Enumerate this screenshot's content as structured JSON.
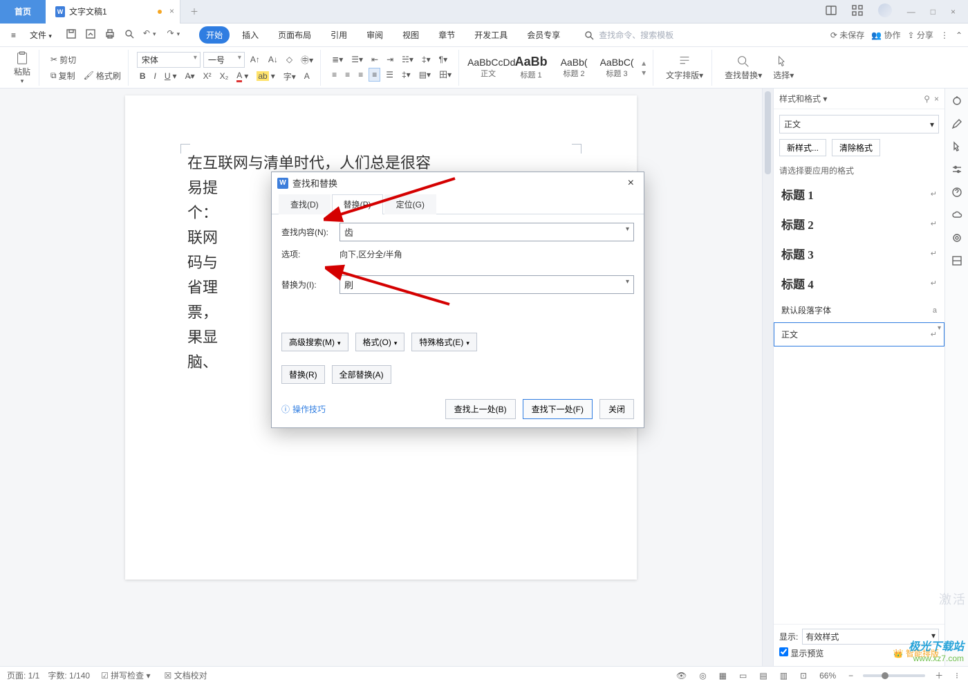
{
  "tabs": {
    "home": "首页",
    "doc": "文字文稿1"
  },
  "window": {
    "min": "—",
    "max": "□",
    "close": "×"
  },
  "menubar": {
    "file": "文件",
    "tabs": [
      "开始",
      "插入",
      "页面布局",
      "引用",
      "审阅",
      "视图",
      "章节",
      "开发工具",
      "会员专享"
    ],
    "search_placeholder": "查找命令、搜索模板",
    "unsaved": "未保存",
    "collab": "协作",
    "share": "分享"
  },
  "ribbon": {
    "paste": "粘贴",
    "cut": "剪切",
    "copy": "复制",
    "format_painter": "格式刷",
    "font_name": "宋体",
    "font_size": "一号",
    "styles": {
      "s0": {
        "preview": "AaBbCcDd",
        "label": "正文"
      },
      "s1": {
        "preview": "AaBb",
        "label": "标题 1"
      },
      "s2": {
        "preview": "AaBb(",
        "label": "标题 2"
      },
      "s3": {
        "preview": "AaBbC(",
        "label": "标题 3"
      }
    },
    "text_layout": "文字排版",
    "find_replace": "查找替换",
    "select": "选择"
  },
  "doc_lines": [
    "在互联网与清单时代，人们总是很容",
    "易提",
    "个：",
    "联网",
    "码与",
    "省理",
    "票，",
    "果显",
    "脑、"
  ],
  "dialog": {
    "title": "查找和替换",
    "tabs": {
      "find": "查找(D)",
      "replace": "替换(P)",
      "goto": "定位(G)"
    },
    "find_label": "查找内容(N):",
    "find_value": "齿",
    "options_label": "选项:",
    "options_value": "向下,区分全/半角",
    "replace_label": "替换为(I):",
    "replace_value": "刷",
    "advanced": "高级搜索(M)",
    "format": "格式(O)",
    "special": "特殊格式(E)",
    "replace_btn": "替换(R)",
    "replace_all": "全部替换(A)",
    "tips": "操作技巧",
    "find_prev": "查找上一处(B)",
    "find_next": "查找下一处(F)",
    "close": "关闭"
  },
  "rpanel": {
    "title": "样式和格式",
    "current_style": "正文",
    "new_style": "新样式...",
    "clear": "清除格式",
    "hint": "请选择要应用的格式",
    "list": [
      "标题 1",
      "标题 2",
      "标题 3",
      "标题 4"
    ],
    "default_font": "默认段落字体",
    "body": "正文",
    "show_label": "显示:",
    "show_value": "有效样式",
    "preview": "显示预览",
    "smart": "智能排版"
  },
  "status": {
    "page": "页面: 1/1",
    "words": "字数: 1/140",
    "spell": "拼写检查",
    "proof": "文档校对",
    "zoom": "66%"
  },
  "watermark": {
    "l1": "极光下载站",
    "l2": "www.xz7.com"
  },
  "activation": "激活"
}
